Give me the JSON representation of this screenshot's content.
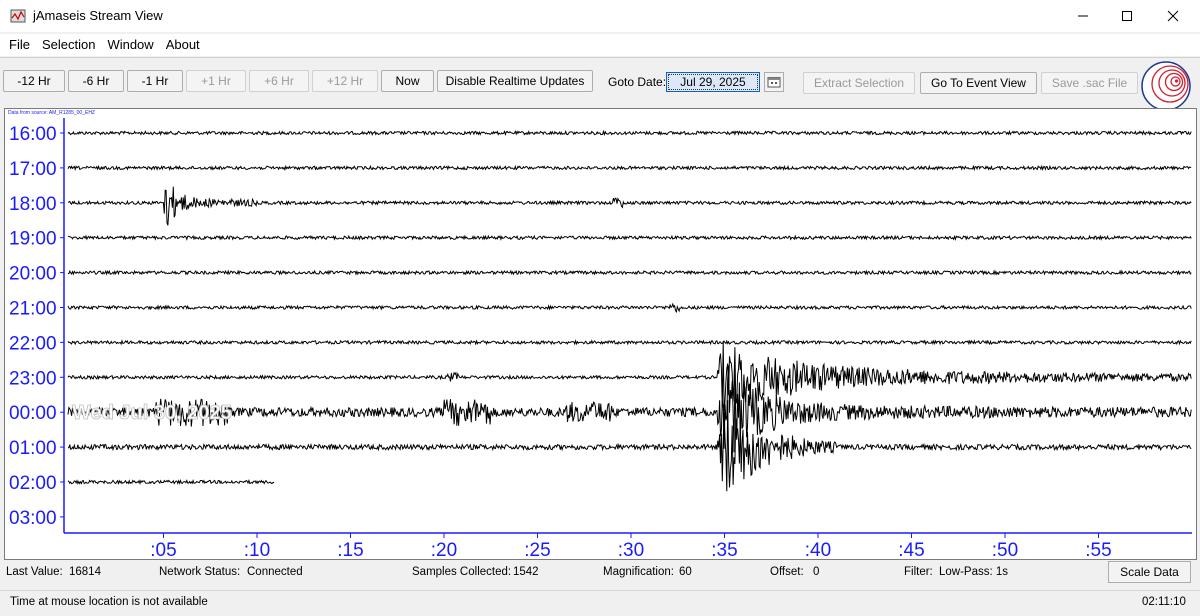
{
  "window": {
    "title": "jAmaseis Stream View",
    "controls": [
      "minimize-icon",
      "maximize-icon",
      "close-icon"
    ]
  },
  "menu": [
    "File",
    "Selection",
    "Window",
    "About"
  ],
  "toolbar": {
    "buttons": [
      {
        "label": "-12 Hr",
        "enabled": true
      },
      {
        "label": "-6 Hr",
        "enabled": true
      },
      {
        "label": "-1 Hr",
        "enabled": true
      },
      {
        "label": "+1 Hr",
        "enabled": false
      },
      {
        "label": "+6 Hr",
        "enabled": false
      },
      {
        "label": "+12 Hr",
        "enabled": false
      },
      {
        "label": "Now",
        "enabled": true
      },
      {
        "label": "Disable Realtime Updates",
        "enabled": true
      }
    ],
    "goto_label": "Goto Date:",
    "goto_value": "Jul 29, 2025",
    "calendar_icon": "calendar-icon",
    "right_buttons": [
      {
        "label": "Extract Selection",
        "enabled": false
      },
      {
        "label": "Go To Event View",
        "enabled": true
      },
      {
        "label": "Save .sac File",
        "enabled": false
      }
    ],
    "logo_icon": "seismic-logo-icon"
  },
  "plot": {
    "source_tag": "Data from source: AM_R1285_00_EHZ",
    "overlay_date": "Wed Jul 30, 2025",
    "hour_labels": [
      "16:00",
      "17:00",
      "18:00",
      "19:00",
      "20:00",
      "21:00",
      "22:00",
      "23:00",
      "00:00",
      "01:00",
      "02:00",
      "03:00"
    ],
    "minute_labels": [
      ":05",
      ":10",
      ":15",
      ":20",
      ":25",
      ":30",
      ":35",
      ":40",
      ":45",
      ":50",
      ":55"
    ],
    "trace_color": "#000000",
    "axis_color": "#1a1aff"
  },
  "status": {
    "last_value_label": "Last Value:",
    "last_value": "16814",
    "network_label": "Network Status:",
    "network_value": "Connected",
    "samples_label": "Samples Collected:",
    "samples_value": "1542",
    "magnification_label": "Magnification:",
    "magnification_value": "60",
    "offset_label": "Offset:",
    "offset_value": "0",
    "filter_label": "Filter:",
    "filter_value": "Low-Pass: 1s",
    "scale_button": "Scale Data"
  },
  "footer": {
    "mouse_message": "Time at mouse location is not available",
    "clock": "02:11:10"
  }
}
